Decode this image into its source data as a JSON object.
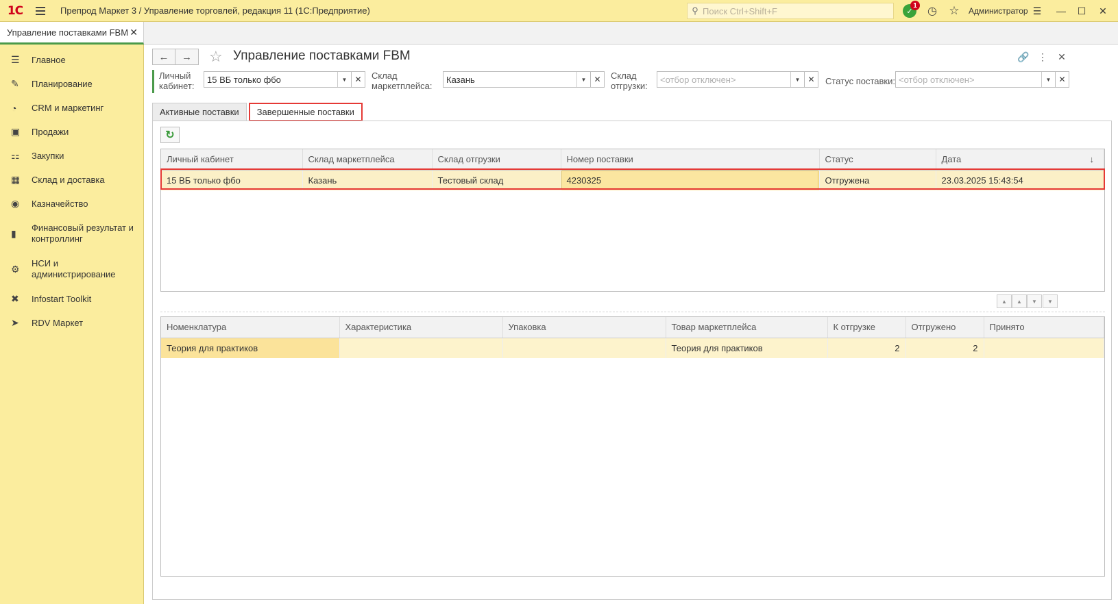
{
  "titlebar": {
    "logo": "1С",
    "app_title": "Препрод Маркет 3 / Управление торговлей, редакция 11  (1С:Предприятие)",
    "search_placeholder": "Поиск Ctrl+Shift+F",
    "notification_count": "1",
    "user": "Администратор"
  },
  "open_tabs": [
    {
      "label": "Управление поставками FBM"
    }
  ],
  "sidebar": {
    "items": [
      {
        "label": "Главное",
        "icon": "menu-lines-icon"
      },
      {
        "label": "Планирование",
        "icon": "planning-icon"
      },
      {
        "label": "CRM и маркетинг",
        "icon": "pie-chart-icon"
      },
      {
        "label": "Продажи",
        "icon": "shopping-bag-icon"
      },
      {
        "label": "Закупки",
        "icon": "cart-icon"
      },
      {
        "label": "Склад и доставка",
        "icon": "grid-icon"
      },
      {
        "label": "Казначейство",
        "icon": "coins-icon"
      },
      {
        "label": "Финансовый результат и контроллинг",
        "icon": "bar-chart-icon"
      },
      {
        "label": "НСИ и администрирование",
        "icon": "gear-icon"
      },
      {
        "label": "Infostart Toolkit",
        "icon": "tools-icon"
      },
      {
        "label": "RDV Маркет",
        "icon": "rocket-icon"
      }
    ]
  },
  "form": {
    "title": "Управление поставками FBM",
    "filters": {
      "cabinet_label": "Личный кабинет:",
      "cabinet_value": "15 ВБ только фбо",
      "mp_warehouse_label": "Склад маркетплейса:",
      "mp_warehouse_value": "Казань",
      "ship_warehouse_label": "Склад отгрузки:",
      "ship_warehouse_placeholder": "<отбор отключен>",
      "status_label": "Статус поставки:",
      "status_placeholder": "<отбор отключен>"
    },
    "tabs": [
      {
        "label": "Активные поставки"
      },
      {
        "label": "Завершенные поставки"
      }
    ],
    "shipments": {
      "columns": [
        "Личный кабинет",
        "Склад маркетплейса",
        "Склад отгрузки",
        "Номер поставки",
        "Статус",
        "Дата"
      ],
      "sort_indicator": "↓",
      "rows": [
        {
          "cabinet": "15 ВБ только фбо",
          "mp_warehouse": "Казань",
          "ship_warehouse": "Тестовый склад",
          "number": "4230325",
          "status": "Отгружена",
          "date": "23.03.2025 15:43:54"
        }
      ]
    },
    "goods": {
      "columns": [
        "Номенклатура",
        "Характеристика",
        "Упаковка",
        "Товар маркетплейса",
        "К отгрузке",
        "Отгружено",
        "Принято"
      ],
      "rows": [
        {
          "item": "Теория для практиков",
          "characteristic": "",
          "package": "",
          "mp_item": "Теория для практиков",
          "to_ship": "2",
          "shipped": "2",
          "accepted": ""
        }
      ]
    }
  },
  "colors": {
    "panel_yellow": "#fbed9e",
    "accent_green": "#4a9a4a",
    "highlight_red": "#e53935",
    "selected_row": "#fbf0c7"
  }
}
